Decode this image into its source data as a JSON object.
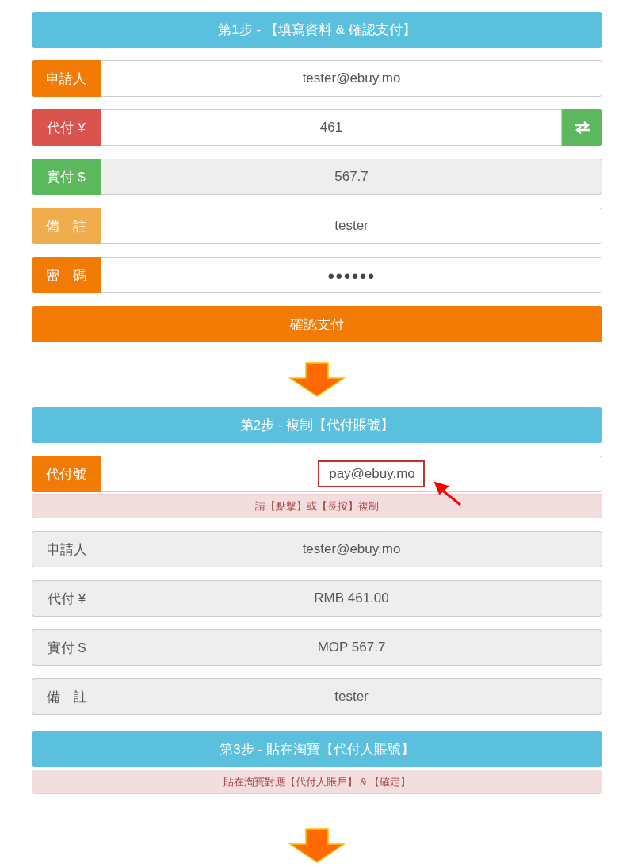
{
  "step1": {
    "title": "第1步 - 【填寫資料 & 確認支付】",
    "fields": [
      {
        "label": "申請人",
        "value": "tester@ebuy.mo",
        "color": "#f27b06",
        "disabled": false,
        "kind": "text"
      },
      {
        "label": "代付 ¥",
        "value": "461",
        "color": "#d9534f",
        "disabled": false,
        "kind": "swap"
      },
      {
        "label": "實付 $",
        "value": "567.7",
        "color": "#5cb85c",
        "disabled": true,
        "kind": "text"
      },
      {
        "label": "備　註",
        "value": "tester",
        "color": "#f0ad4e",
        "disabled": false,
        "kind": "text"
      },
      {
        "label": "密　碼",
        "value": "●●●●●●",
        "color": "#f27b06",
        "disabled": false,
        "kind": "password"
      }
    ],
    "submit": "確認支付"
  },
  "step2": {
    "title": "第2步 - 複制【代付賬號】",
    "account": {
      "label": "代付號",
      "value": "pay@ebuy.mo",
      "color": "#f27b06"
    },
    "hint": "請【點擊】或【長按】複制",
    "details": [
      {
        "label": "申請人",
        "value": "tester@ebuy.mo"
      },
      {
        "label": "代付 ¥",
        "value": "RMB 461.00"
      },
      {
        "label": "實付 $",
        "value": "MOP 567.7"
      },
      {
        "label": "備　註",
        "value": "tester"
      }
    ]
  },
  "step3": {
    "title": "第3步 - 貼在淘寶【代付人賬號】",
    "hint": "貼在淘寶對應【代付人賬戶】 & 【確定】"
  }
}
